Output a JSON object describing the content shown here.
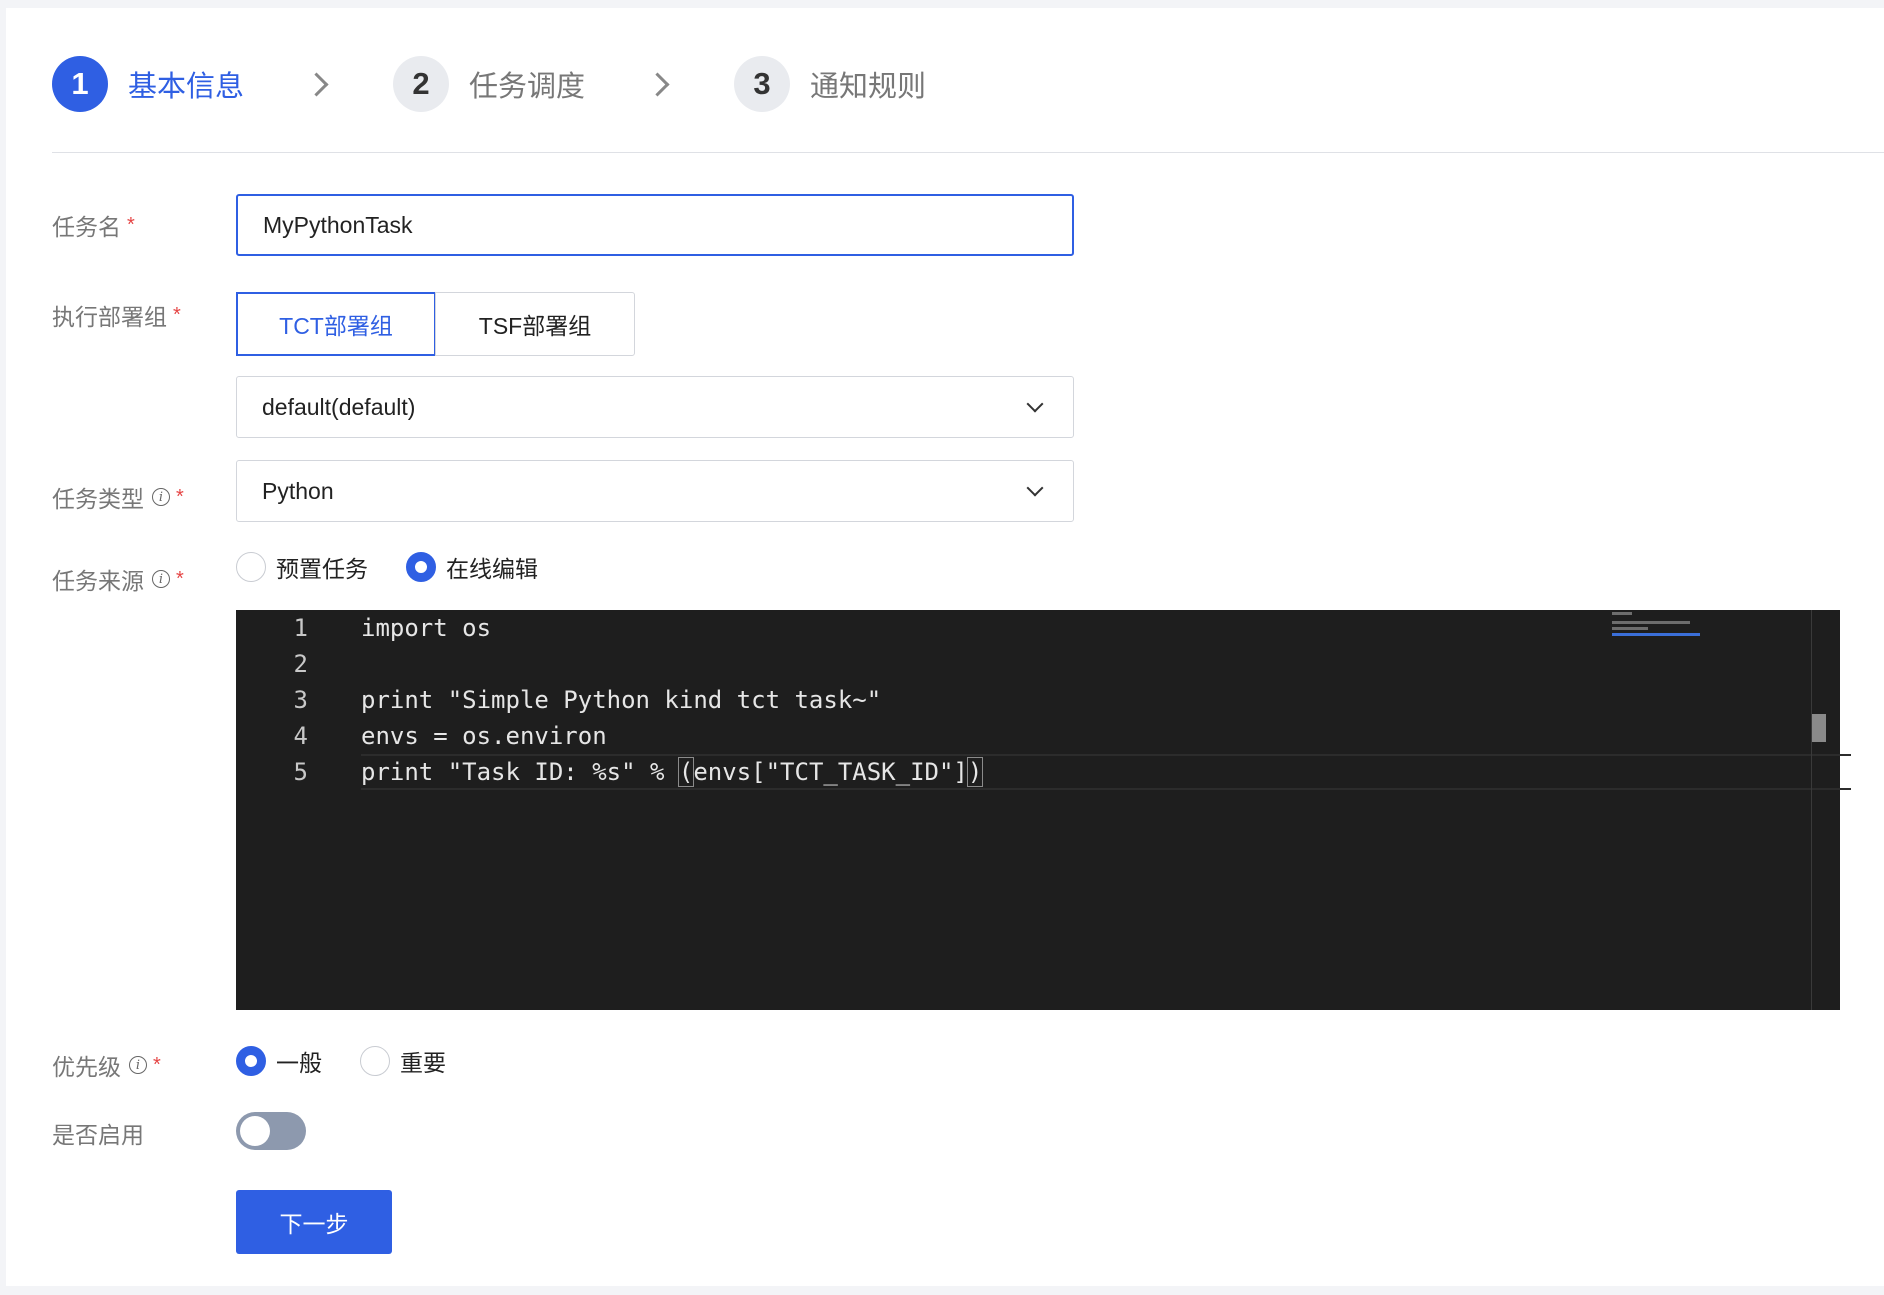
{
  "steps": [
    {
      "num": "1",
      "label": "基本信息",
      "active": true
    },
    {
      "num": "2",
      "label": "任务调度",
      "active": false
    },
    {
      "num": "3",
      "label": "通知规则",
      "active": false
    }
  ],
  "form": {
    "task_name": {
      "label": "任务名",
      "value": "MyPythonTask"
    },
    "deploy_group": {
      "label": "执行部署组",
      "options": [
        "TCT部署组",
        "TSF部署组"
      ],
      "selected": "TCT部署组",
      "namespace_value": "default(default)"
    },
    "task_type": {
      "label": "任务类型",
      "value": "Python"
    },
    "task_source": {
      "label": "任务来源",
      "options": [
        "预置任务",
        "在线编辑"
      ],
      "selected": "在线编辑"
    },
    "code_editor": {
      "lines": [
        {
          "num": "1",
          "text": "import os"
        },
        {
          "num": "2",
          "text": ""
        },
        {
          "num": "3",
          "text": "print \"Simple Python kind tct task~\""
        },
        {
          "num": "4",
          "text": "envs = os.environ"
        },
        {
          "num": "5",
          "text_before": "print \"Task ID: %s\" % ",
          "text_bracket_open": "(",
          "text_middle": "envs[\"TCT_TASK_ID\"]",
          "text_bracket_close": ")"
        }
      ]
    },
    "priority": {
      "label": "优先级",
      "options": [
        "一般",
        "重要"
      ],
      "selected": "一般"
    },
    "enabled": {
      "label": "是否启用",
      "on": false
    },
    "next_button": "下一步"
  },
  "required_mark": "*",
  "info_mark": "i",
  "colors": {
    "accent": "#2f5fe3",
    "required": "#e54545",
    "editor_bg": "#1e1e1e"
  }
}
